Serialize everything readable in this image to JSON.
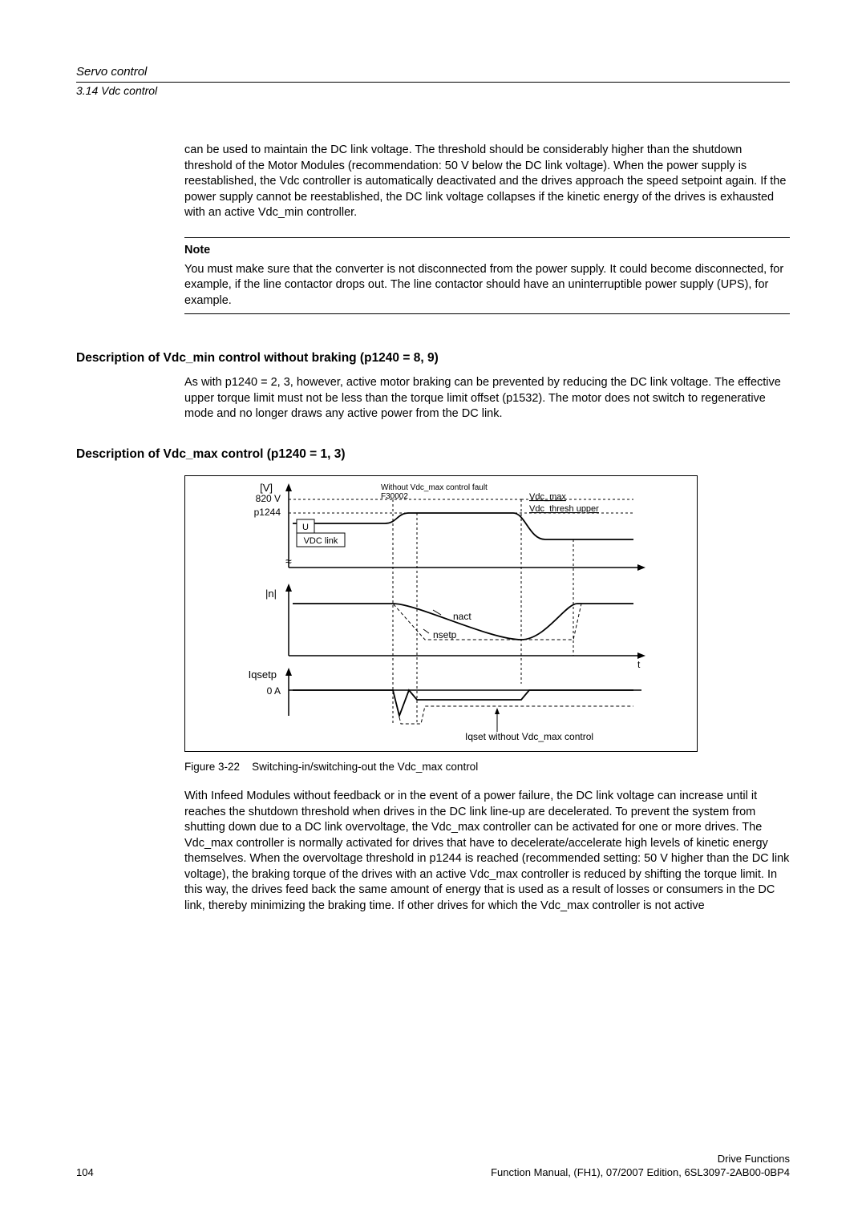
{
  "header": {
    "title": "Servo control",
    "subsection": "3.14 Vdc control"
  },
  "para1": "can be used to maintain the DC link voltage. The threshold should be considerably higher than the shutdown threshold of the Motor Modules (recommendation: 50 V below the DC link voltage). When the power supply is reestablished, the Vdc controller is automatically deactivated and the drives approach the speed setpoint again. If the power supply cannot be reestablished, the DC link voltage collapses if the kinetic energy of the drives is exhausted with an active Vdc_min controller.",
  "note": {
    "label": "Note",
    "text": "You must make sure that the converter is not disconnected from the power supply. It could become disconnected, for example, if the line contactor drops out. The line contactor should have an uninterruptible power supply (UPS), for example."
  },
  "heading1": "Description of Vdc_min control without braking (p1240 = 8, 9)",
  "para2": "As with p1240 = 2, 3, however, active motor braking can be prevented by reducing the DC link voltage. The effective upper torque limit must not be less than the torque limit offset (p1532). The motor does not switch to regenerative mode and no longer draws any active power from the DC link.",
  "heading2": "Description of Vdc_max control (p1240 = 1, 3)",
  "chart_data": {
    "type": "line",
    "plots": [
      {
        "ylabel": "[V]",
        "ticks": [
          "820 V",
          "p1244"
        ],
        "annotations": [
          "Without Vdc_max control fault F30002",
          "Vdc_max",
          "Vdc_thresh upper",
          "U",
          "VDC link"
        ]
      },
      {
        "ylabel": "|n|",
        "annotations": [
          "nact",
          "nsetp"
        ],
        "xlabel_right": "t"
      },
      {
        "ylabel": "Iqsetp",
        "y_tick": "0 A",
        "annotations": [
          "Iqset without Vdc_max control"
        ]
      }
    ]
  },
  "figure_caption": {
    "label": "Figure 3-22",
    "text": "Switching-in/switching-out the Vdc_max control"
  },
  "para3": "With Infeed Modules without feedback or in the event of a power failure, the DC link voltage can increase until it reaches the shutdown threshold when drives in the DC link line-up are decelerated. To prevent the system from shutting down due to a DC link overvoltage, the Vdc_max controller can be activated for one or more drives. The Vdc_max controller is normally activated for drives that have to decelerate/accelerate high levels of kinetic energy themselves. When the overvoltage threshold in p1244 is reached (recommended setting: 50 V higher than the DC link voltage), the braking torque of the drives with an active Vdc_max controller is reduced by shifting the torque limit. In this way, the drives feed back the same amount of energy that is used as a result of losses or consumers in the DC link, thereby minimizing the braking time. If other drives for which the Vdc_max controller is not active",
  "footer": {
    "page": "104",
    "right1": "Drive Functions",
    "right2": "Function Manual, (FH1), 07/2007 Edition, 6SL3097-2AB00-0BP4"
  }
}
